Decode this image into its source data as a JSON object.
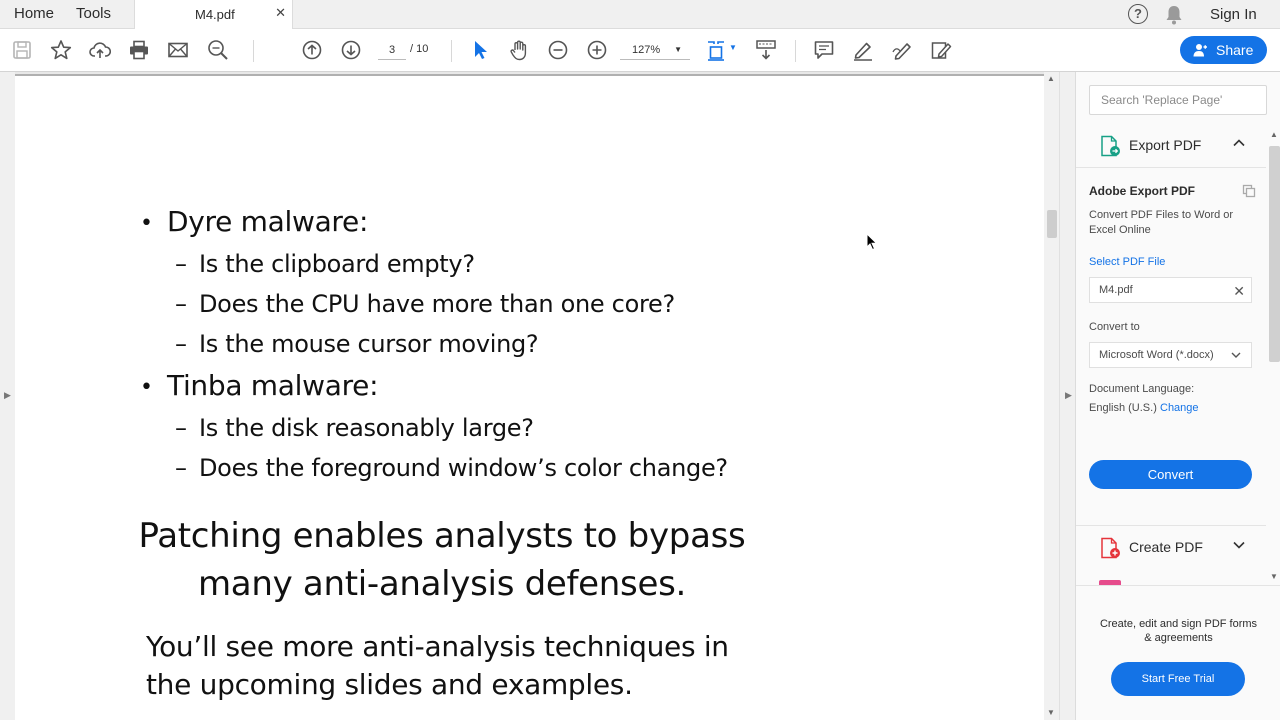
{
  "tabs": {
    "home": "Home",
    "tools": "Tools",
    "document": "M4.pdf",
    "close": "✕"
  },
  "header": {
    "help": "?",
    "signin": "Sign In"
  },
  "toolbar": {
    "current_page": "3",
    "page_total": "/ 10",
    "zoom": "127%",
    "share_label": "Share"
  },
  "slide": {
    "heading1": "Dyre malware:",
    "heading1_items": [
      "Is the clipboard empty?",
      "Does the CPU have more than one core?",
      "Is the mouse cursor moving?"
    ],
    "heading2": "Tinba malware:",
    "heading2_items": [
      "Is the disk reasonably large?",
      "Does the foreground window’s color change?"
    ],
    "dash": "–",
    "bullet": "•",
    "statement_line1": "Patching enables analysts to bypass",
    "statement_line2": "many anti-analysis defenses.",
    "para_line1": "You’ll see more anti-analysis techniques in",
    "para_line2": "the upcoming slides and examples."
  },
  "panel": {
    "search_placeholder": "Search 'Replace Page'",
    "export_label": "Export PDF",
    "adobe_export_title": "Adobe Export PDF",
    "adobe_export_desc": "Convert PDF Files to Word or Excel Online",
    "select_file_label": "Select PDF File",
    "file_name": "M4.pdf",
    "convert_to_label": "Convert to",
    "convert_to_value": "Microsoft Word (*.docx)",
    "doc_language_label": "Document Language:",
    "doc_language_value": "English (U.S.)",
    "change_label": "Change",
    "convert_button": "Convert",
    "create_pdf_label": "Create PDF",
    "promo_text": "Create, edit and sign PDF forms & agreements",
    "trial_button": "Start Free Trial"
  },
  "colors": {
    "accent": "#1473e6",
    "export_icon": "#17a086",
    "create_icon": "#e5343b"
  }
}
